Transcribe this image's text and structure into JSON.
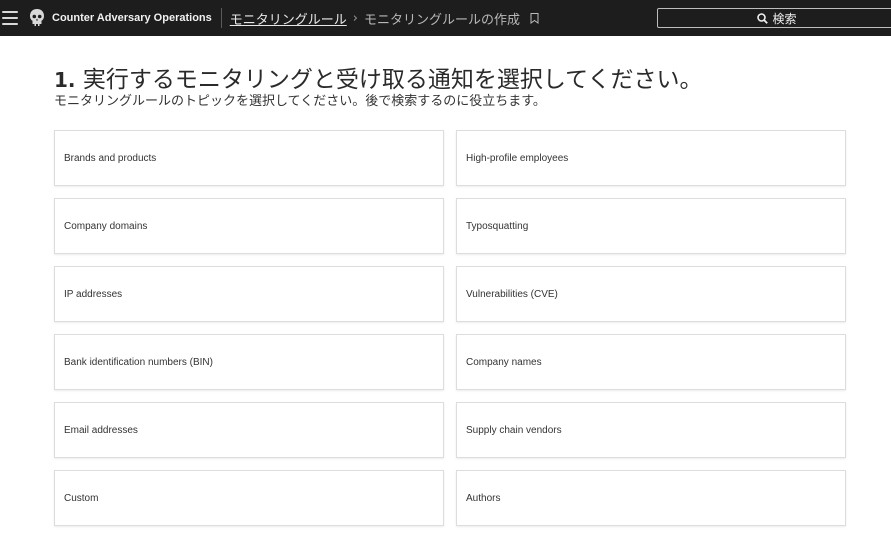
{
  "header": {
    "brand": "Counter Adversary Operations",
    "breadcrumb": {
      "link": "モニタリングルール",
      "separator": "›",
      "current": "モニタリングルールの作成"
    },
    "search_label": "検索",
    "icons": {
      "menu": "hamburger-menu-icon",
      "logo": "falcon-skull-logo-icon",
      "bookmark": "bookmark-icon",
      "search": "search-icon"
    }
  },
  "main": {
    "heading_number": "1.",
    "heading_text": "実行するモニタリングと受け取る通知を選択してください。",
    "subheading": "モニタリングルールのトピックを選択してください。後で検索するのに役立ちます。",
    "topics": [
      "Brands and products",
      "High-profile employees",
      "Company domains",
      "Typosquatting",
      "IP addresses",
      "Vulnerabilities (CVE)",
      "Bank identification numbers (BIN)",
      "Company names",
      "Email addresses",
      "Supply chain vendors",
      "Custom",
      "Authors"
    ]
  },
  "colors": {
    "topbar_bg": "#1d1d1d",
    "card_border": "#dddddd"
  }
}
